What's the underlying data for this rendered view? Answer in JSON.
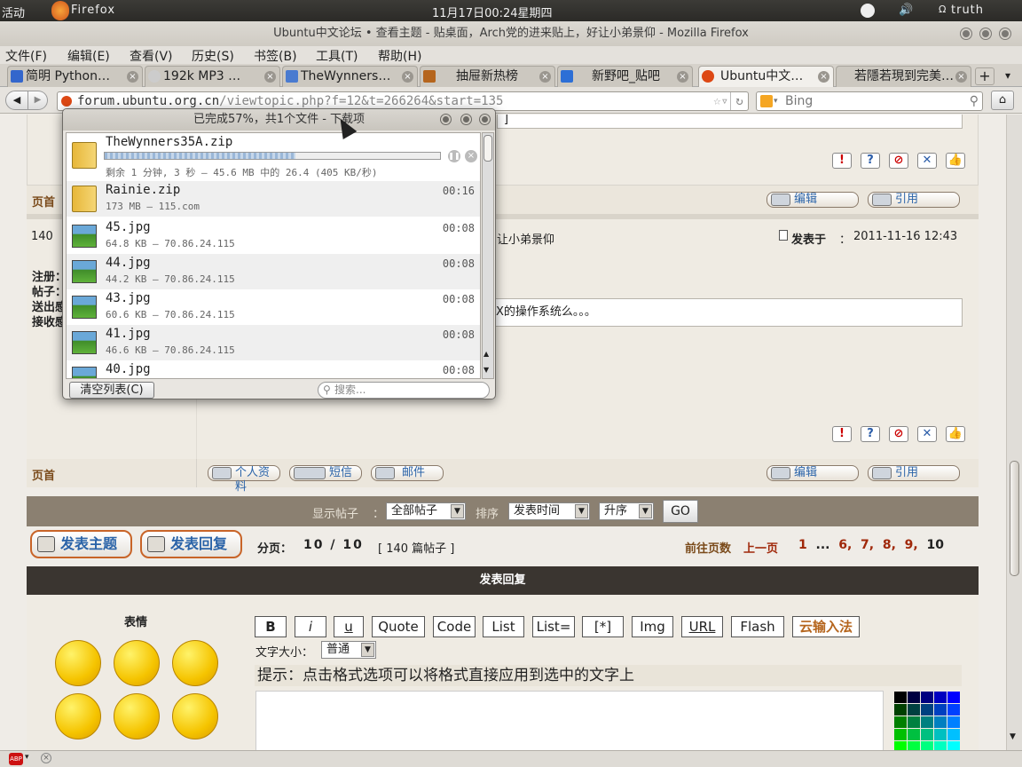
{
  "panel": {
    "activities": "活动",
    "app_name": "Firefox",
    "clock": "11月17日00:24星期四",
    "user": "truth"
  },
  "window": {
    "title": "Ubuntu中文论坛 • 查看主题 - 贴桌面，Arch党的进来贴上，好让小弟景仰 - Mozilla Firefox"
  },
  "menu": [
    "文件(F)",
    "编辑(E)",
    "查看(V)",
    "历史(S)",
    "书签(B)",
    "工具(T)",
    "帮助(H)"
  ],
  "tabs": [
    {
      "label": "简明 Python…",
      "icon_color": "#3366cc"
    },
    {
      "label": "192k MP3 …",
      "icon_color": "#cccccc"
    },
    {
      "label": "TheWynners…",
      "icon_color": "#4a7bd0"
    },
    {
      "label": "抽屉新热榜",
      "icon_color": "#b5651d"
    },
    {
      "label": "新野吧_贴吧",
      "icon_color": "#2d6fd6"
    },
    {
      "label": "Ubuntu中文…",
      "icon_color": "#dd4814",
      "active": true
    },
    {
      "label": "若隱若現到完美…",
      "icon_color": "#cccccc"
    }
  ],
  "nav": {
    "url_domain": "forum.ubuntu.org.cn",
    "url_path": "/viewtopic.php?f=12&t=266264&start=135",
    "search_placeholder": "Bing"
  },
  "downloads": {
    "title": "已完成57%，共1个文件 - 下载项",
    "items": [
      {
        "name": "TheWynners35A.zip",
        "status": "剩余 1 分钟, 3 秒 — 45.6 MB 中的 26.4 (405 KB/秒)",
        "time": "",
        "type": "zip",
        "progress": 0.57
      },
      {
        "name": "Rainie.zip",
        "status": "173 MB — 115.com",
        "time": "00:16",
        "type": "zip"
      },
      {
        "name": "45.jpg",
        "status": "64.8 KB — 70.86.24.115",
        "time": "00:08",
        "type": "jpg"
      },
      {
        "name": "44.jpg",
        "status": "44.2 KB — 70.86.24.115",
        "time": "00:08",
        "type": "jpg"
      },
      {
        "name": "43.jpg",
        "status": "60.6 KB — 70.86.24.115",
        "time": "00:08",
        "type": "jpg"
      },
      {
        "name": "41.jpg",
        "status": "46.6 KB — 70.86.24.115",
        "time": "00:08",
        "type": "jpg"
      },
      {
        "name": "40.jpg",
        "status": "",
        "time": "00:08",
        "type": "jpg"
      }
    ],
    "clear_label": "清空列表(C)",
    "search_placeholder": "搜索..."
  },
  "page": {
    "top_link": "页首",
    "edit_label": "编辑",
    "quote_label": "引用",
    "post_number": "140",
    "post_title_fragment": "让小弟景仰",
    "posted_label": "发表于",
    "posted_date": "2011-11-16 12:43",
    "profile_labels": [
      "注册：",
      "帖子：",
      "送出感",
      "接收感"
    ],
    "post_body_fragment": "用X的操作系统么。。。",
    "profile_btn": "个人资料",
    "pm_btn": "短信",
    "email_btn": "邮件",
    "filter_label": "显示帖子",
    "filter_value": "全部帖子",
    "sort_label": "排序",
    "sort_value": "发表时间",
    "order_value": "升序",
    "go_label": "GO",
    "new_topic": "发表主题",
    "reply": "发表回复",
    "pages_label": "分页：",
    "pages_value": "10 / 10",
    "post_count": "[ 140 篇帖子 ]",
    "goto_label": "前往页数",
    "prev_label": "上一页",
    "page_links": [
      "1",
      "...",
      "6,",
      "7,",
      "8,",
      "9,",
      "10"
    ],
    "reply_header": "发表回复",
    "smilies_label": "表情",
    "fmt_buttons": [
      "B",
      "i",
      "u",
      "Quote",
      "Code",
      "List",
      "List=",
      "[*]",
      "Img",
      "URL",
      "Flash",
      "云输入法"
    ],
    "font_size_label": "文字大小：",
    "font_size_value": "普通",
    "hint": "提示：点击格式选项可以将格式直接应用到选中的文字上"
  }
}
